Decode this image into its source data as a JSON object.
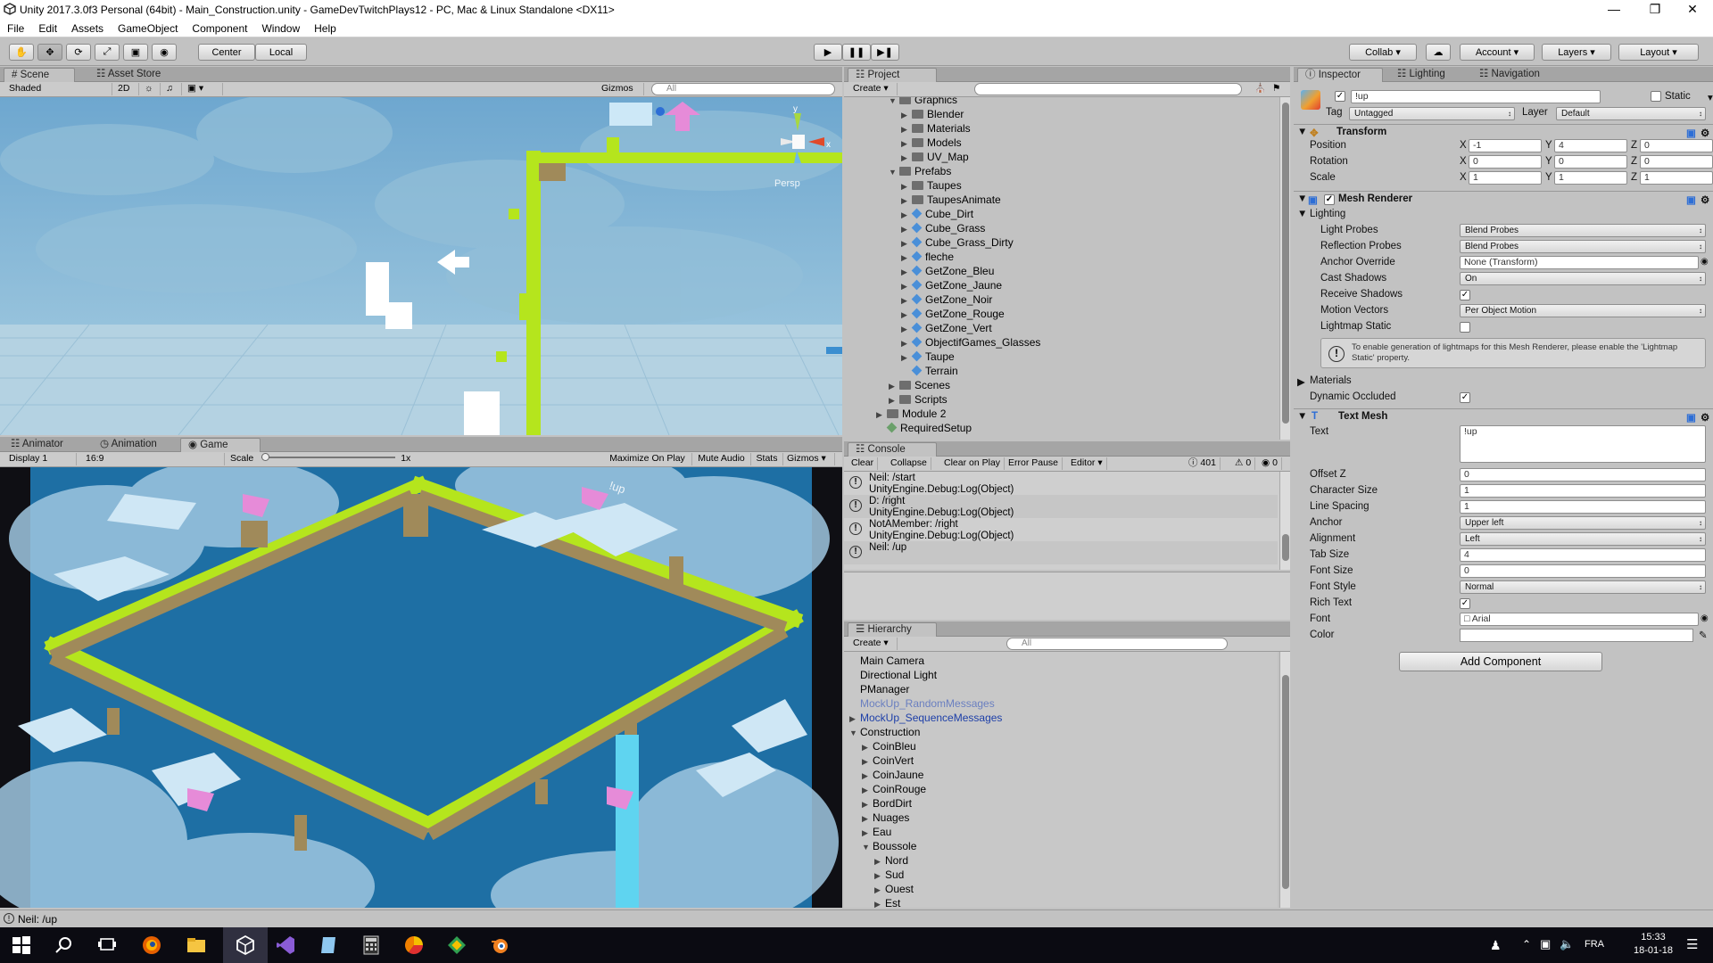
{
  "window": {
    "title": "Unity 2017.3.0f3 Personal (64bit) - Main_Construction.unity - GameDevTwitchPlays12 - PC, Mac & Linux Standalone <DX11>"
  },
  "menu": [
    "File",
    "Edit",
    "Assets",
    "GameObject",
    "Component",
    "Window",
    "Help"
  ],
  "toolbar": {
    "center": "Center",
    "local": "Local",
    "collab": "Collab",
    "account": "Account",
    "layers": "Layers",
    "layout": "Layout"
  },
  "scene": {
    "tabs": [
      "Scene",
      "Asset Store"
    ],
    "shaded": "Shaded",
    "mode2d": "2D",
    "gizmos": "Gizmos",
    "search": "All",
    "persp": "Persp",
    "axis_y": "y",
    "axis_x": "x"
  },
  "game": {
    "tabs": [
      "Animator",
      "Animation",
      "Game"
    ],
    "display": "Display 1",
    "aspect": "16:9",
    "scale_label": "Scale",
    "scale_value": "1x",
    "buttons": [
      "Maximize On Play",
      "Mute Audio",
      "Stats",
      "Gizmos"
    ],
    "world_text": "!up"
  },
  "project": {
    "tab": "Project",
    "create": "Create",
    "items": [
      {
        "label": "Graphics",
        "depth": 4,
        "kind": "folder",
        "open": true
      },
      {
        "label": "Blender",
        "depth": 5,
        "kind": "folder"
      },
      {
        "label": "Materials",
        "depth": 5,
        "kind": "folder"
      },
      {
        "label": "Models",
        "depth": 5,
        "kind": "folder"
      },
      {
        "label": "UV_Map",
        "depth": 5,
        "kind": "folder"
      },
      {
        "label": "Prefabs",
        "depth": 4,
        "kind": "folder",
        "open": true
      },
      {
        "label": "Taupes",
        "depth": 5,
        "kind": "folder"
      },
      {
        "label": "TaupesAnimate",
        "depth": 5,
        "kind": "folder"
      },
      {
        "label": "Cube_Dirt",
        "depth": 5,
        "kind": "prefab"
      },
      {
        "label": "Cube_Grass",
        "depth": 5,
        "kind": "prefab"
      },
      {
        "label": "Cube_Grass_Dirty",
        "depth": 5,
        "kind": "prefab"
      },
      {
        "label": "fleche",
        "depth": 5,
        "kind": "prefab"
      },
      {
        "label": "GetZone_Bleu",
        "depth": 5,
        "kind": "prefab"
      },
      {
        "label": "GetZone_Jaune",
        "depth": 5,
        "kind": "prefab"
      },
      {
        "label": "GetZone_Noir",
        "depth": 5,
        "kind": "prefab"
      },
      {
        "label": "GetZone_Rouge",
        "depth": 5,
        "kind": "prefab"
      },
      {
        "label": "GetZone_Vert",
        "depth": 5,
        "kind": "prefab"
      },
      {
        "label": "ObjectifGames_Glasses",
        "depth": 5,
        "kind": "prefab"
      },
      {
        "label": "Taupe",
        "depth": 5,
        "kind": "prefab"
      },
      {
        "label": "Terrain",
        "depth": 5,
        "kind": "prefab",
        "noarrow": true
      },
      {
        "label": "Scenes",
        "depth": 4,
        "kind": "folder"
      },
      {
        "label": "Scripts",
        "depth": 4,
        "kind": "folder"
      },
      {
        "label": "Module 2",
        "depth": 3,
        "kind": "folder"
      },
      {
        "label": "RequiredSetup",
        "depth": 3,
        "kind": "asset",
        "noarrow": true
      }
    ]
  },
  "console": {
    "tab": "Console",
    "buttons": [
      "Clear",
      "Collapse",
      "Clear on Play",
      "Error Pause",
      "Editor"
    ],
    "count_warn": "401",
    "count_err": "0",
    "count_info": "0",
    "entries": [
      {
        "l1": "Neil: /start",
        "l2": "UnityEngine.Debug:Log(Object)"
      },
      {
        "l1": "D: /right",
        "l2": "UnityEngine.Debug:Log(Object)"
      },
      {
        "l1": "NotAMember: /right",
        "l2": "UnityEngine.Debug:Log(Object)"
      },
      {
        "l1": "Neil: /up",
        "l2": ""
      }
    ]
  },
  "hierarchy": {
    "tab": "Hierarchy",
    "create": "Create",
    "search": "All",
    "items": [
      {
        "label": "Main Camera",
        "depth": 0,
        "arrow": ""
      },
      {
        "label": "Directional Light",
        "depth": 0,
        "arrow": ""
      },
      {
        "label": "PManager",
        "depth": 0,
        "arrow": ""
      },
      {
        "label": "MockUp_RandomMessages",
        "depth": 0,
        "arrow": "",
        "style": "prefab-dim"
      },
      {
        "label": "MockUp_SequenceMessages",
        "depth": 0,
        "arrow": "right",
        "style": "prefab"
      },
      {
        "label": "Construction",
        "depth": 0,
        "arrow": "down"
      },
      {
        "label": "CoinBleu",
        "depth": 1,
        "arrow": "right"
      },
      {
        "label": "CoinVert",
        "depth": 1,
        "arrow": "right"
      },
      {
        "label": "CoinJaune",
        "depth": 1,
        "arrow": "right"
      },
      {
        "label": "CoinRouge",
        "depth": 1,
        "arrow": "right"
      },
      {
        "label": "BordDirt",
        "depth": 1,
        "arrow": "right"
      },
      {
        "label": "Nuages",
        "depth": 1,
        "arrow": "right"
      },
      {
        "label": "Eau",
        "depth": 1,
        "arrow": "right"
      },
      {
        "label": "Boussole",
        "depth": 1,
        "arrow": "down"
      },
      {
        "label": "Nord",
        "depth": 2,
        "arrow": "right"
      },
      {
        "label": "Sud",
        "depth": 2,
        "arrow": "right"
      },
      {
        "label": "Ouest",
        "depth": 2,
        "arrow": "right"
      },
      {
        "label": "Est",
        "depth": 2,
        "arrow": "right"
      }
    ]
  },
  "inspector": {
    "tabs": [
      "Inspector",
      "Lighting",
      "Navigation"
    ],
    "name": "!up",
    "static": "Static",
    "tag_label": "Tag",
    "tag": "Untagged",
    "layer_label": "Layer",
    "layer": "Default",
    "transform": {
      "title": "Transform",
      "rows": [
        {
          "label": "Position",
          "x": "-1",
          "y": "4",
          "z": "0"
        },
        {
          "label": "Rotation",
          "x": "0",
          "y": "0",
          "z": "0"
        },
        {
          "label": "Scale",
          "x": "1",
          "y": "1",
          "z": "1"
        }
      ]
    },
    "mesh_renderer": {
      "title": "Mesh Renderer",
      "lighting": "Lighting",
      "light_probes_label": "Light Probes",
      "light_probes": "Blend Probes",
      "reflection_label": "Reflection Probes",
      "reflection": "Blend Probes",
      "anchor_override_label": "Anchor Override",
      "anchor_override": "None (Transform)",
      "cast_label": "Cast Shadows",
      "cast": "On",
      "receive_label": "Receive Shadows",
      "motion_label": "Motion Vectors",
      "motion": "Per Object Motion",
      "lightmap_label": "Lightmap Static",
      "info": "To enable generation of lightmaps for this Mesh Renderer, please enable the 'Lightmap Static' property.",
      "materials": "Materials",
      "dyn_label": "Dynamic Occluded"
    },
    "text_mesh": {
      "title": "Text Mesh",
      "text_label": "Text",
      "text": "!up",
      "offset_label": "Offset Z",
      "offset": "0",
      "char_label": "Character Size",
      "char": "1",
      "spacing_label": "Line Spacing",
      "spacing": "1",
      "anchor_label": "Anchor",
      "anchor": "Upper left",
      "align_label": "Alignment",
      "align": "Left",
      "tab_label": "Tab Size",
      "tab": "4",
      "fsize_label": "Font Size",
      "fsize": "0",
      "fstyle_label": "Font Style",
      "fstyle": "Normal",
      "rich_label": "Rich Text",
      "font_label": "Font",
      "font": "Arial",
      "color_label": "Color"
    },
    "add_component": "Add Component"
  },
  "status_bar": {
    "text": "Neil: /up"
  },
  "taskbar": {
    "lang": "FRA",
    "time": "15:33",
    "date": "18-01-18"
  },
  "colors": {
    "sky": "#7fb6d8",
    "water": "#1d6ea5",
    "grass": "#b5e51d",
    "dirt": "#a08a5a",
    "pink": "#e68bd8"
  }
}
